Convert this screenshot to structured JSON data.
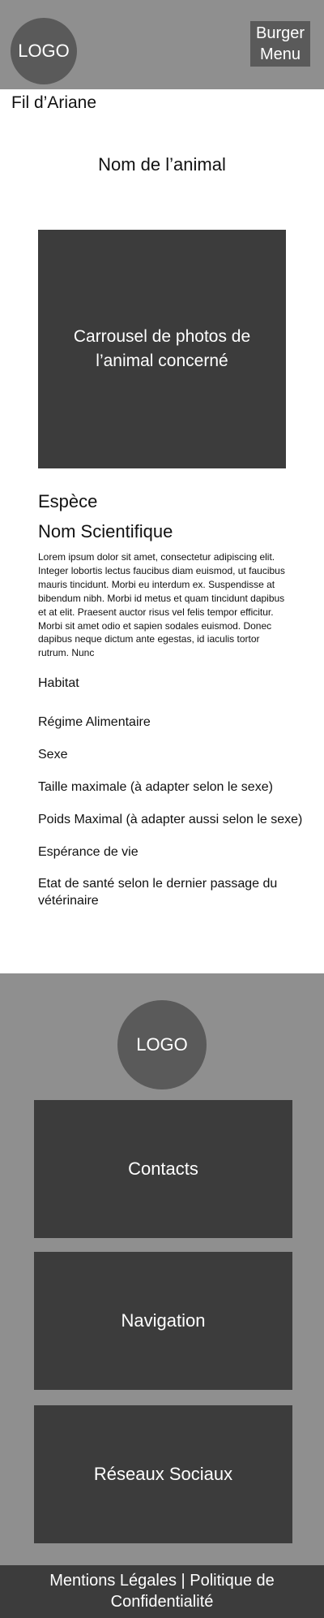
{
  "header": {
    "logo": "LOGO",
    "burger_menu": "Burger\nMenu"
  },
  "breadcrumb": "Fil d’Ariane",
  "animal_name": "Nom de l’animal",
  "carousel": "Carrousel de photos de l’animal concerné",
  "details": {
    "species": "Espèce",
    "scientific_name": "Nom Scientifique",
    "description": "Lorem ipsum dolor sit amet, consectetur adipiscing elit. Integer lobortis lectus faucibus diam euismod, ut faucibus mauris tincidunt. Morbi eu interdum ex. Suspendisse at bibendum nibh. Morbi id metus et quam tincidunt dapibus et at elit. Praesent auctor risus vel felis tempor efficitur. Morbi sit amet odio et sapien sodales euismod. Donec dapibus neque dictum ante egestas, id iaculis tortor rutrum. Nunc",
    "habitat": "Habitat",
    "diet": "Régime Alimentaire",
    "sex": "Sexe",
    "max_size": "Taille maximale (à adapter selon le sexe)",
    "max_weight": "Poids Maximal (à adapter aussi selon le sexe)",
    "life_expectancy": "Espérance de vie",
    "health_status": "Etat de santé selon le dernier passage  du vétérinaire"
  },
  "footer": {
    "logo": "LOGO",
    "contacts": "Contacts",
    "navigation": "Navigation",
    "social": "Réseaux Sociaux",
    "legal": "Mentions Légales | Politique de Confidentialité"
  }
}
